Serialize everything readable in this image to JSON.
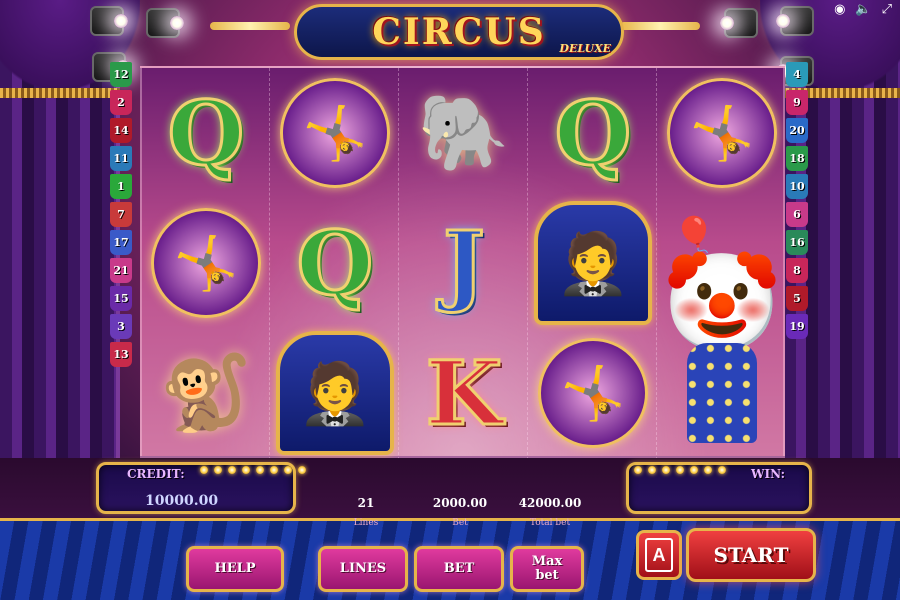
{
  "window": {
    "icons": [
      "casino-chip-icon",
      "sound-icon",
      "fullscreen-icon"
    ]
  },
  "logo": {
    "title": "CIRCUS",
    "subtitle": "DELUXE"
  },
  "reels": [
    [
      "Q",
      "acrobat",
      "monkey"
    ],
    [
      "acrobat",
      "Q",
      "ringmaster"
    ],
    [
      "elephant",
      "J",
      "K"
    ],
    [
      "Q",
      "ringmaster",
      "acrobat"
    ],
    [
      "acrobat",
      "clown",
      "clown"
    ]
  ],
  "paylines": {
    "left": [
      {
        "n": "12",
        "color": "#2a9a4a"
      },
      {
        "n": "2",
        "color": "#c8265a"
      },
      {
        "n": "14",
        "color": "#b01a2a"
      },
      {
        "n": "11",
        "color": "#2a7ab8"
      },
      {
        "n": "1",
        "color": "#2aa83a"
      },
      {
        "n": "7",
        "color": "#c83a3a"
      },
      {
        "n": "17",
        "color": "#3a5ac8"
      },
      {
        "n": "21",
        "color": "#c83a8a"
      },
      {
        "n": "15",
        "color": "#6a2aa8"
      },
      {
        "n": "3",
        "color": "#6a3ab8"
      },
      {
        "n": "13",
        "color": "#c82a4a"
      }
    ],
    "right": [
      {
        "n": "4",
        "color": "#2a9ab8"
      },
      {
        "n": "9",
        "color": "#c8266a"
      },
      {
        "n": "20",
        "color": "#2a6ac8"
      },
      {
        "n": "18",
        "color": "#2a9a4a"
      },
      {
        "n": "10",
        "color": "#2a7ab8"
      },
      {
        "n": "6",
        "color": "#c83a8a"
      },
      {
        "n": "16",
        "color": "#2a8a5a"
      },
      {
        "n": "8",
        "color": "#c8265a"
      },
      {
        "n": "5",
        "color": "#b01a2a"
      },
      {
        "n": "19",
        "color": "#6a2ab8"
      }
    ]
  },
  "panel": {
    "credit_label": "CREDIT:",
    "credit_value": "10000.00",
    "win_label": "WIN:",
    "win_value": "",
    "lines_value": "21",
    "lines_label": "Lines",
    "bet_value": "2000.00",
    "bet_label": "Bet",
    "total_bet_value": "42000.00",
    "total_bet_label": "Total bet"
  },
  "buttons": {
    "help": "HELP",
    "lines": "LINES",
    "bet": "BET",
    "max_bet_line1": "Max",
    "max_bet_line2": "bet",
    "auto": "A",
    "start": "START"
  },
  "colors": {
    "accent_gold": "#e6b44a",
    "button_pink": "#e03a9e",
    "start_red": "#f04040",
    "panel_blue": "#1a3aa8"
  }
}
